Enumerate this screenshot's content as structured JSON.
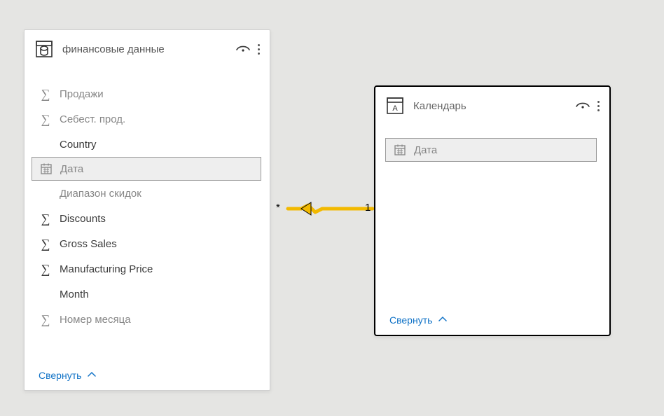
{
  "canvas": {
    "background": "#e5e5e3"
  },
  "tables": {
    "financial": {
      "title": "финансовые данные",
      "footer_label": "Свернуть",
      "fields": [
        {
          "label": "Продажи",
          "icon": "sigma",
          "dim": true
        },
        {
          "label": "Себест. прод.",
          "icon": "sigma",
          "dim": true
        },
        {
          "label": "Country",
          "icon": "none",
          "dim": false
        },
        {
          "label": "Дата",
          "icon": "calendar",
          "dim": true,
          "selected": true
        },
        {
          "label": "Диапазон скидок",
          "icon": "none",
          "dim": true
        },
        {
          "label": "Discounts",
          "icon": "sigma",
          "dim": false
        },
        {
          "label": "Gross Sales",
          "icon": "sigma",
          "dim": false
        },
        {
          "label": "Manufacturing Price",
          "icon": "sigma",
          "dim": false
        },
        {
          "label": "Month",
          "icon": "none",
          "dim": false
        },
        {
          "label": "Номер месяца",
          "icon": "sigma",
          "dim": true
        }
      ]
    },
    "calendar": {
      "title": "Календарь",
      "footer_label": "Свернуть",
      "fields": [
        {
          "label": "Дата",
          "icon": "calendar",
          "dim": true,
          "selected": true
        }
      ]
    }
  },
  "relationship": {
    "left_cardinality": "*",
    "right_cardinality": "1",
    "color": "#f2b900"
  }
}
